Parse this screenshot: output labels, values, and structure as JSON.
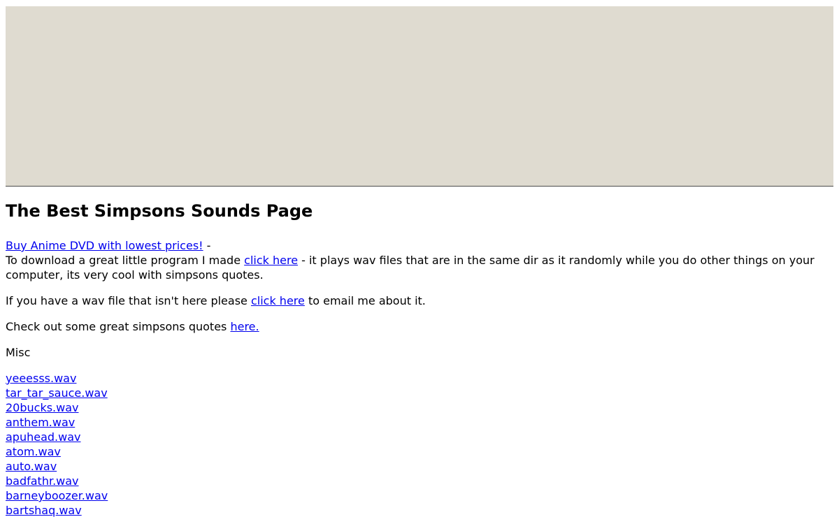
{
  "page": {
    "title": "The Best Simpsons Sounds Page"
  },
  "intro": {
    "ad_link": "Buy Anime DVD with lowest prices!",
    "ad_suffix": " -",
    "download_prefix": "To download a great little program I made ",
    "download_link": "click here",
    "download_suffix": " - it plays wav files that are in the same dir as it randomly while you do other things on your computer, its very cool with simpsons quotes."
  },
  "email": {
    "prefix": "If you have a wav file that isn't here please ",
    "link": "click here",
    "suffix": " to email me about it."
  },
  "quotes": {
    "prefix": "Check out some great simpsons quotes ",
    "link": "here."
  },
  "section": {
    "heading": "Misc"
  },
  "files": [
    "yeeesss.wav",
    "tar_tar_sauce.wav",
    "20bucks.wav",
    "anthem.wav",
    "apuhead.wav",
    "atom.wav",
    "auto.wav",
    "badfathr.wav",
    "barneyboozer.wav",
    "bartshaq.wav"
  ],
  "colors": {
    "banner": "#dfdbd0",
    "link": "#0000ee"
  }
}
